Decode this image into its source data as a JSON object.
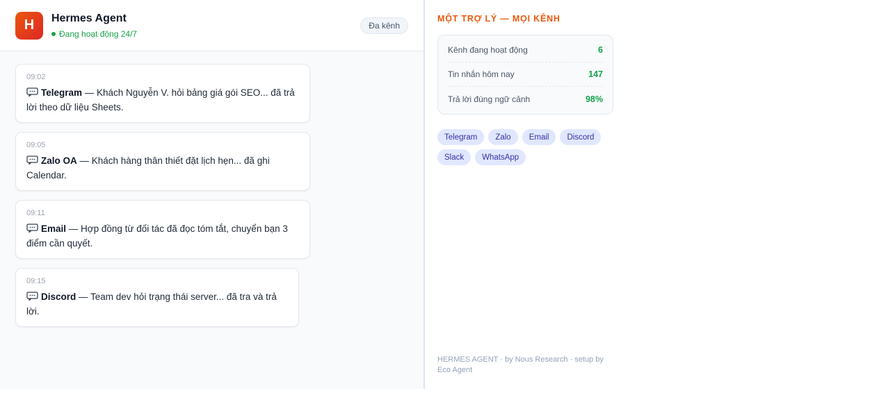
{
  "header": {
    "logo_letter": "H",
    "title": "Hermes Agent",
    "status": "Đang hoạt động 24/7",
    "badge": "Đa kênh"
  },
  "feed": [
    {
      "time": "09:02",
      "channel": "Telegram",
      "text": " — Khách Nguyễn V. hỏi bảng giá gói SEO... đã trả lời theo dữ liệu Sheets."
    },
    {
      "time": "09:05",
      "channel": "Zalo OA",
      "text": " — Khách hàng thân thiết đặt lịch hẹn... đã ghi Calendar."
    },
    {
      "time": "09:11",
      "channel": "Email",
      "text": " — Hợp đồng từ đối tác đã đọc tóm tắt, chuyển bạn 3 điểm cần quyết."
    },
    {
      "time": "09:15",
      "channel": "Discord",
      "text": " — Team dev hỏi trạng thái server... đã tra và trả lời."
    }
  ],
  "sidebar": {
    "title": "MỘT TRỢ LÝ — MỌI KÊNH",
    "stats": [
      {
        "label": "Kênh đang hoạt động",
        "value": "6"
      },
      {
        "label": "Tin nhắn hôm nay",
        "value": "147"
      },
      {
        "label": "Trả lời đúng ngữ cảnh",
        "value": "98%"
      }
    ],
    "chips": [
      "Telegram",
      "Zalo",
      "Email",
      "Discord",
      "Slack",
      "WhatsApp"
    ],
    "footer": "HERMES AGENT · by Nous Research · setup by Eco Agent"
  },
  "colors": {
    "accent": "#ea580c",
    "status_green": "#16a34a",
    "chip_bg": "#e0e7ff",
    "chip_text": "#3730a3"
  },
  "icons": {
    "message": "chat-bubble-icon"
  }
}
